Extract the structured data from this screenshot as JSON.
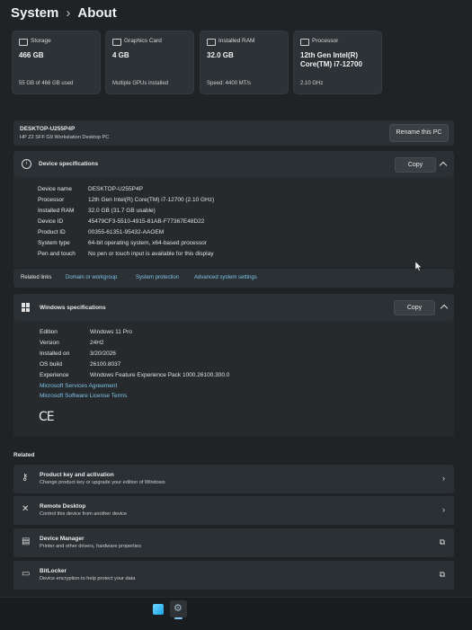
{
  "breadcrumb": {
    "parent": "System",
    "separator": "›",
    "current": "About"
  },
  "tiles": [
    {
      "label": "Storage",
      "value": "466 GB",
      "sub": "55 GB of 466 GB used",
      "icon": "storage-icon"
    },
    {
      "label": "Graphics Card",
      "value": "4 GB",
      "sub": "Multiple GPUs installed",
      "icon": "graphics-card-icon"
    },
    {
      "label": "Installed RAM",
      "value": "32.0 GB",
      "sub": "Speed: 4400 MT/s",
      "icon": "ram-icon"
    },
    {
      "label": "Processor",
      "value": "12th Gen Intel(R) Core(TM) i7-12700",
      "sub": "2.10 GHz",
      "icon": "processor-icon"
    }
  ],
  "pc": {
    "name": "DESKTOP-U255P4P",
    "model": "HP Z2 SFF G9 Workstation Desktop PC",
    "rename_label": "Rename this PC"
  },
  "device_specs": {
    "title": "Device specifications",
    "copy_label": "Copy",
    "rows": [
      {
        "key": "Device name",
        "value": "DESKTOP-U255P4P"
      },
      {
        "key": "Processor",
        "value": "12th Gen Intel(R) Core(TM) i7-12700 (2.10 GHz)"
      },
      {
        "key": "Installed RAM",
        "value": "32.0 GB (31.7 GB usable)"
      },
      {
        "key": "Device ID",
        "value": "45479CF3-5510-4915-81AB-F77367E48D22"
      },
      {
        "key": "Product ID",
        "value": "00355-61351-95432-AAOEM"
      },
      {
        "key": "System type",
        "value": "64-bit operating system, x64-based processor"
      },
      {
        "key": "Pen and touch",
        "value": "No pen or touch input is available for this display"
      }
    ]
  },
  "related_links": {
    "label": "Related links",
    "links": [
      "Domain or workgroup",
      "System protection",
      "Advanced system settings"
    ]
  },
  "windows_specs": {
    "title": "Windows specifications",
    "copy_label": "Copy",
    "rows": [
      {
        "key": "Edition",
        "value": "Windows 11 Pro"
      },
      {
        "key": "Version",
        "value": "24H2"
      },
      {
        "key": "Installed on",
        "value": "3/20/2026"
      },
      {
        "key": "OS build",
        "value": "26100.8037"
      },
      {
        "key": "Experience",
        "value": "Windows Feature Experience Pack 1000.26100.300.0"
      }
    ],
    "links": [
      "Microsoft Services Agreement",
      "Microsoft Software License Terms"
    ],
    "ce_mark": "CE"
  },
  "related": {
    "heading": "Related",
    "items": [
      {
        "title": "Product key and activation",
        "sub": "Change product key or upgrade your edition of Windows",
        "icon": "key-icon",
        "glyph": "⚷",
        "arrow": "›"
      },
      {
        "title": "Remote Desktop",
        "sub": "Control this device from another device",
        "icon": "remote-desktop-icon",
        "glyph": "✕",
        "arrow": "›"
      },
      {
        "title": "Device Manager",
        "sub": "Printer and other drivers, hardware properties",
        "icon": "device-manager-icon",
        "glyph": "▤",
        "arrow": "⧉"
      },
      {
        "title": "BitLocker",
        "sub": "Device encryption to help protect your data",
        "icon": "bitlocker-icon",
        "glyph": "▭",
        "arrow": "⧉"
      }
    ]
  }
}
